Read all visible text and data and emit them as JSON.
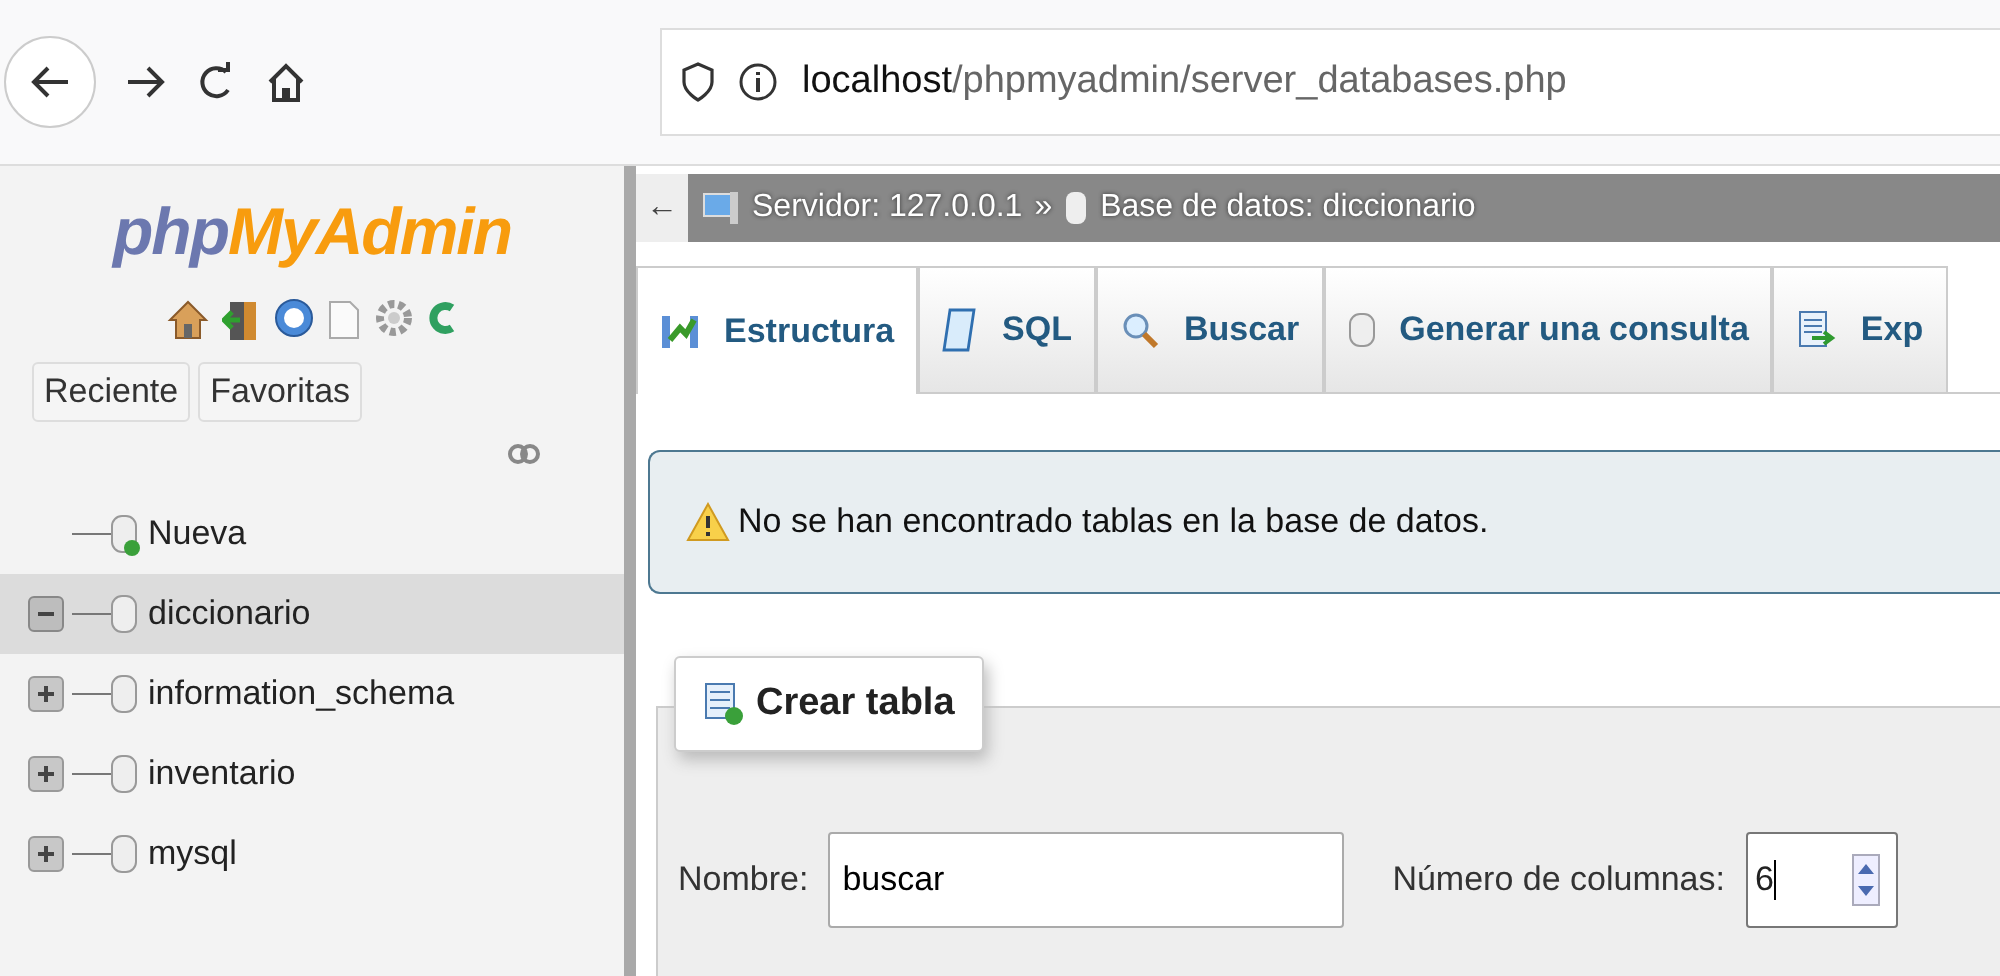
{
  "browser": {
    "url_host": "localhost",
    "url_path": "/phpmyadmin/server_databases.php"
  },
  "sidebar": {
    "logo_left": "php",
    "logo_right": "MyAdmin",
    "tabs": [
      {
        "label": "Reciente"
      },
      {
        "label": "Favoritas"
      }
    ],
    "tree": [
      {
        "kind": "new",
        "label": "Nueva",
        "selected": false
      },
      {
        "kind": "db",
        "label": "diccionario",
        "selected": true,
        "expanded": true
      },
      {
        "kind": "db",
        "label": "information_schema",
        "selected": false,
        "expanded": false
      },
      {
        "kind": "db",
        "label": "inventario",
        "selected": false,
        "expanded": false
      },
      {
        "kind": "db",
        "label": "mysql",
        "selected": false,
        "expanded": false
      }
    ]
  },
  "breadcrumb": {
    "back": "←",
    "server": "Servidor: 127.0.0.1",
    "separator": "»",
    "database": "Base de datos: diccionario"
  },
  "tabs": [
    {
      "label": "Estructura",
      "selected": true
    },
    {
      "label": "SQL",
      "selected": false
    },
    {
      "label": "Buscar",
      "selected": false
    },
    {
      "label": "Generar una consulta",
      "selected": false
    },
    {
      "label": "Exp",
      "selected": false
    }
  ],
  "notice": "No se han encontrado tablas en la base de datos.",
  "create_table": {
    "legend": "Crear tabla",
    "name_label": "Nombre:",
    "name_value": "buscar",
    "columns_label": "Número de columnas:",
    "columns_value": "6"
  }
}
